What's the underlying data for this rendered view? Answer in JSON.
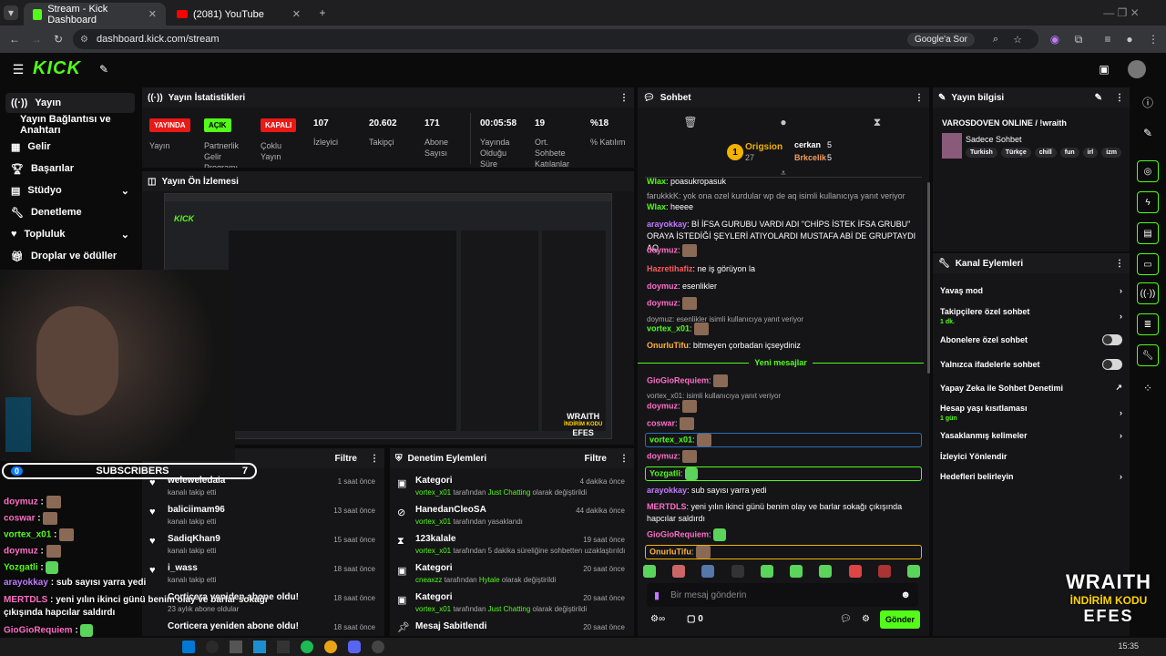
{
  "browser": {
    "tabs": [
      {
        "title": "Stream - Kick Dashboard"
      },
      {
        "title": "(2081) YouTube"
      }
    ],
    "url": "dashboard.kick.com/stream",
    "google_btn": "Google'a Sor"
  },
  "sidebar": {
    "items": [
      {
        "label": "Yayın"
      },
      {
        "label": "Yayın Bağlantısı ve Anahtarı"
      },
      {
        "label": "Gelir"
      },
      {
        "label": "Başarılar"
      },
      {
        "label": "Stüdyo"
      },
      {
        "label": "Denetleme"
      },
      {
        "label": "Topluluk"
      },
      {
        "label": "Droplar ve ödüller"
      }
    ]
  },
  "stats": {
    "title": "Yayın İstatistikleri",
    "items": [
      {
        "value": "YAYINDA",
        "label": "Yayın",
        "color": "#e91916"
      },
      {
        "value": "AÇIK",
        "label": "Partnerlik Gelir Programı",
        "color": "#53fc18"
      },
      {
        "value": "KAPALI",
        "label": "Çoklu Yayın",
        "color": "#e91916"
      },
      {
        "value": "107",
        "label": "İzleyici"
      },
      {
        "value": "20.602",
        "label": "Takipçi"
      },
      {
        "value": "171",
        "label": "Abone Sayısı"
      },
      {
        "value": "00:05:58",
        "label": "Yayında Olduğu Süre"
      },
      {
        "value": "19",
        "label": "Ort. Sohbete Katılanlar"
      },
      {
        "value": "%18",
        "label": "% Katılım"
      }
    ]
  },
  "preview": {
    "title": "Yayın Ön İzlemesi",
    "wraith1": "WRAITH",
    "wraith2": "İNDİRİM KODU",
    "wraith3": "EFES"
  },
  "activity": {
    "filter": "Filtre",
    "rows": [
      {
        "title": "weleweledaia",
        "sub": "kanalı takip etti",
        "time": "1 saat önce"
      },
      {
        "title": "baliciimam96",
        "sub": "kanalı takip etti",
        "time": "13 saat önce"
      },
      {
        "title": "SadiqKhan9",
        "sub": "kanalı takip etti",
        "time": "15 saat önce"
      },
      {
        "title": "i_wass",
        "sub": "kanalı takip etti",
        "time": "18 saat önce"
      },
      {
        "title": "Corticera yeniden abone oldu!",
        "sub": "23 aylık abone oldular",
        "time": "18 saat önce"
      },
      {
        "title": "Corticera yeniden abone oldu!",
        "sub": "",
        "time": "18 saat önce"
      }
    ]
  },
  "moderation": {
    "title": "Denetim Eylemleri",
    "filter": "Filtre",
    "rows": [
      {
        "title": "Kategori",
        "user": "vortex_x01",
        "mid": " tarafından ",
        "hl": "Just Chatting",
        "end": " olarak değiştirildi",
        "time": "4 dakika önce"
      },
      {
        "title": "HanedanCleoSA",
        "user": "vortex_x01",
        "mid": " tarafından yasaklandı",
        "hl": "",
        "end": "",
        "time": "44 dakika önce"
      },
      {
        "title": "123kalale",
        "user": "vortex_x01",
        "mid": " tarafından 5 dakika süreliğine sohbetten uzaklaştırıldı",
        "hl": "",
        "end": "",
        "time": "19 saat önce"
      },
      {
        "title": "Kategori",
        "user": "cneaxzz",
        "mid": " tarafından ",
        "hl": "Hytale",
        "end": " olarak değiştirildi",
        "time": "20 saat önce"
      },
      {
        "title": "Kategori",
        "user": "vortex_x01",
        "mid": " tarafından ",
        "hl": "Just Chatting",
        "end": " olarak değiştirildi",
        "time": "20 saat önce"
      },
      {
        "title": "Mesaj Sabitlendi",
        "user": "",
        "mid": "",
        "hl": "",
        "end": "",
        "time": "20 saat önce"
      }
    ]
  },
  "chat": {
    "title": "Sohbet",
    "top1": "Origsion",
    "top1_count": "27",
    "top2": "cerkan",
    "top2_count": "5",
    "top3": "Brkcelik",
    "top3_count": "5",
    "new_messages": "Yeni mesajlar",
    "input_placeholder": "Bir mesaj gönderin",
    "send": "Gönder",
    "viewer_count": "0",
    "messages": [
      {
        "user": "Wlax",
        "text": ": poasukropasuk",
        "color": "#53fc18"
      },
      {
        "user": "",
        "text": "farukkkK: yok ona ozel kurdular wp de aq isimli kullanıcıya yanıt veriyor",
        "color": "#a8a8a8",
        "reply": true
      },
      {
        "user": "Wlax",
        "text": ": heeee",
        "color": "#53fc18"
      },
      {
        "user": "arayokkay",
        "text": ": Bİ İFSA GURUBU VARDI ADI \"CHİPS İSTEK İFSA GRUBU\" ORAYA İSTEDİĞİ ŞEYLERİ ATIYOLARDI MUSTAFA ABİ DE GRUPTAYDI AQ",
        "color": "#c07bff"
      },
      {
        "user": "doymuz",
        "text": ":",
        "color": "#ff6ec7"
      },
      {
        "user": "Hazretihafiz",
        "text": ": ne iş görüyon la",
        "color": "#ff5a5a"
      },
      {
        "user": "doymuz",
        "text": ": esenlikler",
        "color": "#ff6ec7"
      },
      {
        "user": "doymuz",
        "text": ":",
        "color": "#ff6ec7"
      },
      {
        "user": "",
        "text": "doymuz: esenlikler isimli kullanıcıya yanıt veriyor",
        "color": "#a8a8a8",
        "reply": true
      },
      {
        "user": "vortex_x01",
        "text": ":",
        "color": "#53fc18"
      },
      {
        "user": "OnurluTifu",
        "text": ": bitmeyen çorbadan içseydiniz",
        "color": "#ffb23b"
      },
      {
        "user": "GioGioRequiem",
        "text": ":",
        "color": "#ff6ec7"
      },
      {
        "user": "",
        "text": "vortex_x01: isimli kullanıcıya yanıt veriyor",
        "color": "#a8a8a8",
        "reply": true
      },
      {
        "user": "doymuz",
        "text": ":",
        "color": "#ff6ec7"
      },
      {
        "user": "coswar",
        "text": ":",
        "color": "#ff6ec7"
      },
      {
        "user": "vortex_x01",
        "text": ":",
        "color": "#53fc18"
      },
      {
        "user": "doymuz",
        "text": ":",
        "color": "#ff6ec7"
      },
      {
        "user": "Yozgatli",
        "text": ":",
        "color": "#53fc18"
      },
      {
        "user": "arayokkay",
        "text": ": sub sayısı yarra yedi",
        "color": "#c07bff"
      },
      {
        "user": "MERTDLS",
        "text": ": yeni yılın ikinci günü benim olay ve barlar sokağı çıkışında hapcılar saldırdı",
        "color": "#ff6ec7"
      },
      {
        "user": "GioGioRequiem",
        "text": ":",
        "color": "#ff6ec7"
      },
      {
        "user": "OnurluTifu",
        "text": ":",
        "color": "#ffb23b"
      }
    ]
  },
  "info": {
    "title": "Yayın bilgisi",
    "stream_title": "VAROSDOVEN ONLINE / !wraith",
    "category": "Sadece Sohbet",
    "tags": [
      "Turkish",
      "Türkçe",
      "chill",
      "fun",
      "irl",
      "izm"
    ]
  },
  "channel_actions": {
    "title": "Kanal Eylemleri",
    "items": [
      {
        "label": "Yavaş mod",
        "sub": ""
      },
      {
        "label": "Takipçilere özel sohbet",
        "sub": "1 dk."
      },
      {
        "label": "Abonelere özel sohbet",
        "sub": ""
      },
      {
        "label": "Yalnızca ifadelerle sohbet",
        "sub": ""
      },
      {
        "label": "Yapay Zeka ile Sohbet Denetimi",
        "sub": ""
      },
      {
        "label": "Hesap yaşı kısıtlaması",
        "sub": "1 gün"
      },
      {
        "label": "Yasaklanmış kelimeler",
        "sub": ""
      },
      {
        "label": "İzleyici Yönlendir",
        "sub": ""
      },
      {
        "label": "Hedefleri belirleyin",
        "sub": ""
      }
    ]
  },
  "overlay": {
    "subs_label": "SUBSCRIBERS",
    "subs_left": "0",
    "subs_right": "7",
    "chat": [
      {
        "user": "doymuz",
        "text": " :"
      },
      {
        "user": "coswar",
        "text": " :"
      },
      {
        "user": "vortex_x01",
        "text": " :"
      },
      {
        "user": "doymuz",
        "text": " :"
      },
      {
        "user": "Yozgatli",
        "text": " :"
      },
      {
        "user": "arayokkay",
        "text": " : sub sayısı yarra yedi"
      },
      {
        "user": "MERTDLS",
        "text": " : yeni yılın ikinci günü benim olay ve barlar sokağı çıkışında hapcılar saldırdı"
      },
      {
        "user": "GioGioRequiem",
        "text": " :"
      }
    ],
    "wraith": "WRAITH",
    "discount": "İNDİRİM KODU",
    "code": "EFES"
  },
  "taskbar": {
    "time": "15:35"
  }
}
